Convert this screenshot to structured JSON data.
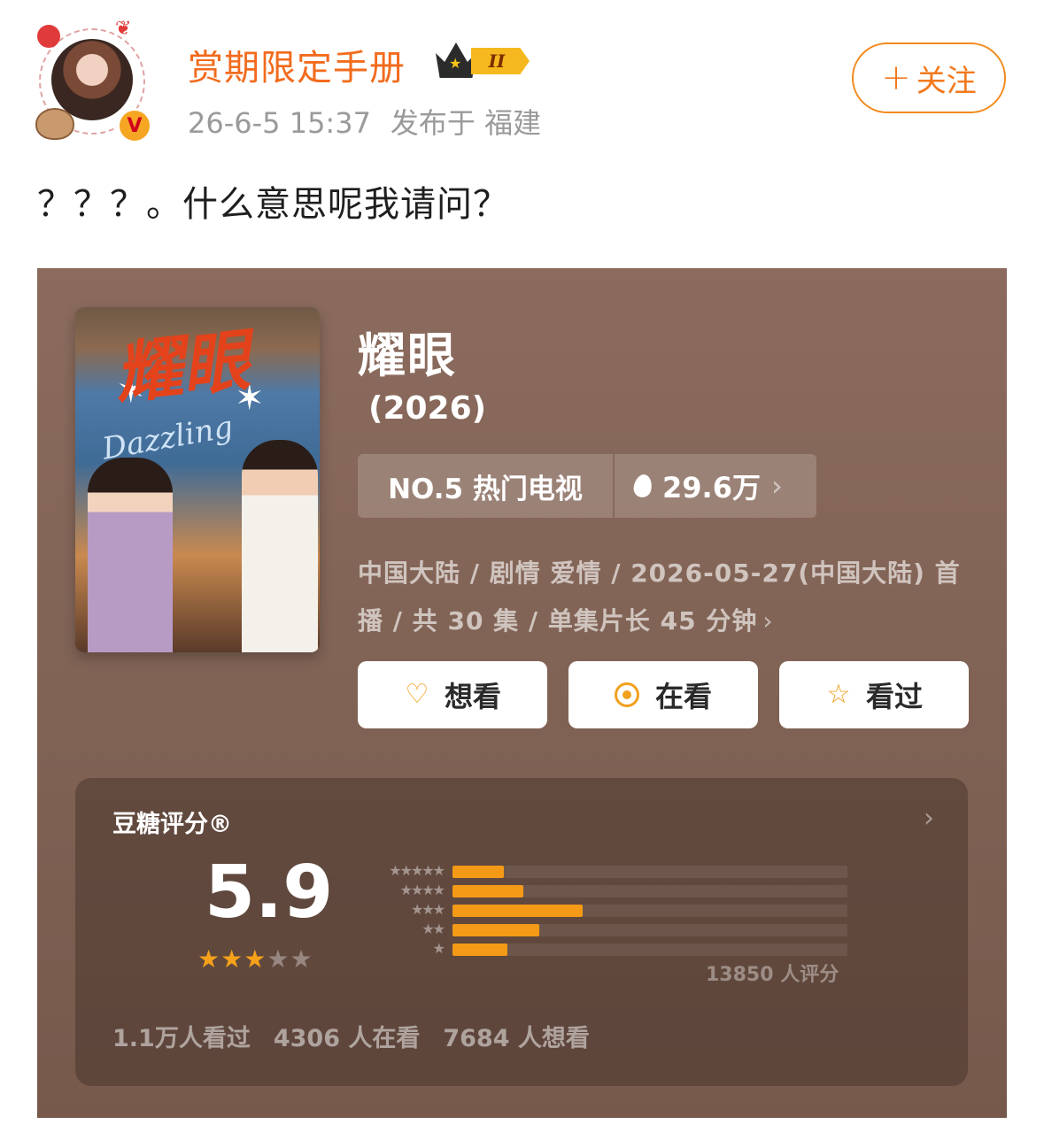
{
  "post": {
    "username": "赏期限定手册",
    "level_badge": "II",
    "timestamp": "26-6-5 15:37",
    "location": "发布于 福建",
    "follow_label": "关注",
    "text": "？？？。什么意思呢我请问？",
    "accent_color": "#f26b1d"
  },
  "show": {
    "poster_title": "耀眼",
    "poster_script": "Dazzling",
    "title": "耀眼",
    "year": "(2026)",
    "rank": "NO.5 热门电视",
    "heat": "29.6万",
    "info": "中国大陆 / 剧情 爱情 / 2026-05-27(中国大陆) 首播 / 共 30 集 / 单集片长 45 分钟",
    "actions": [
      {
        "label": "想看",
        "icon": "heart-plus-icon"
      },
      {
        "label": "在看",
        "icon": "target-icon"
      },
      {
        "label": "看过",
        "icon": "star-outline-icon"
      }
    ]
  },
  "rating": {
    "label": "豆糖评分®",
    "score": "5.9",
    "stars_filled": 3,
    "stars_total": 5,
    "count": "13850 人评分",
    "distribution": [
      {
        "stars": 5,
        "share": 0.13
      },
      {
        "stars": 4,
        "share": 0.18
      },
      {
        "stars": 3,
        "share": 0.33
      },
      {
        "stars": 2,
        "share": 0.22
      },
      {
        "stars": 1,
        "share": 0.14
      }
    ],
    "watched": "1.1万人看过",
    "watching": "4306 人在看",
    "want": "7684 人想看",
    "bar_color": "#f59a16"
  }
}
